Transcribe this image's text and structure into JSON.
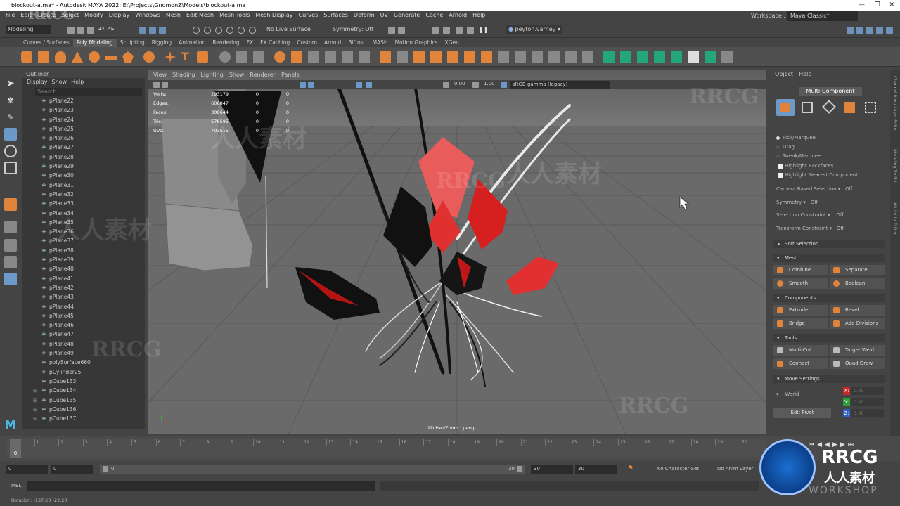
{
  "window": {
    "title": "blockout-a.ma* - Autodesk MAYA 2022: E:\\Projects\\GnomonZ\\Models\\blockout-a.ma"
  },
  "menubar": [
    "File",
    "Edit",
    "Create",
    "Select",
    "Modify",
    "Display",
    "Windows",
    "Mesh",
    "Edit Mesh",
    "Mesh Tools",
    "Mesh Display",
    "Curves",
    "Surfaces",
    "Deform",
    "UV",
    "Generate",
    "Cache",
    "Arnold",
    "Help"
  ],
  "workspace": {
    "label": "Workspace :",
    "value": "Maya Classic*"
  },
  "statusline": {
    "mode": "Modeling",
    "live_surface": "No Live Surface",
    "symmetry": "Symmetry: Off",
    "user": "peyton.varney"
  },
  "shelf_tabs": [
    "Curves / Surfaces",
    "Poly Modeling",
    "Sculpting",
    "Rigging",
    "Animation",
    "Rendering",
    "FX",
    "FX Caching",
    "Custom",
    "Arnold",
    "Bifrost",
    "MASH",
    "Motion Graphics",
    "XGen"
  ],
  "shelf_active": "Poly Modeling",
  "outliner": {
    "title": "Outliner",
    "menus": [
      "Display",
      "Show",
      "Help"
    ],
    "search_placeholder": "Search...",
    "items": [
      "pPlane22",
      "pPlane23",
      "pPlane24",
      "pPlane25",
      "pPlane26",
      "pPlane27",
      "pPlane28",
      "pPlane29",
      "pPlane30",
      "pPlane31",
      "pPlane32",
      "pPlane33",
      "pPlane34",
      "pPlane35",
      "pPlane36",
      "pPlane37",
      "pPlane38",
      "pPlane39",
      "pPlane40",
      "pPlane41",
      "pPlane42",
      "pPlane43",
      "pPlane44",
      "pPlane45",
      "pPlane46",
      "pPlane47",
      "pPlane48",
      "pPlane49",
      "polySurface660",
      "pCylinder25",
      "pCube133",
      "pCube134",
      "pCube135",
      "pCube136",
      "pCube137"
    ]
  },
  "viewport": {
    "menus": [
      "View",
      "Shading",
      "Lighting",
      "Show",
      "Renderer",
      "Panels"
    ],
    "exposure": "0.00",
    "gamma": "1.00",
    "colorspace": "sRGB gamma (legacy)",
    "camera": "2D Pan/Zoom : persp",
    "hud": [
      {
        "label": "Verts:",
        "value": "293179",
        "a": "0",
        "b": "0"
      },
      {
        "label": "Edges:",
        "value": "600847",
        "a": "0",
        "b": "0"
      },
      {
        "label": "Faces:",
        "value": "308644",
        "a": "0",
        "b": "0"
      },
      {
        "label": "Tris:",
        "value": "576585",
        "a": "0",
        "b": "0"
      },
      {
        "label": "UVs:",
        "value": "703515",
        "a": "0",
        "b": "0"
      }
    ]
  },
  "toolkit": {
    "menus": [
      "Object",
      "Help"
    ],
    "mode": "Multi-Component",
    "pick": "Pick/Marquee",
    "drag": "Drag",
    "tweak": "Tweak/Marquee",
    "backfaces": "Highlight Backfaces",
    "nearest": "Highlight Nearest Component",
    "camera_sel": "Camera Based Selection",
    "camera_sel_val": "Off",
    "symmetry": "Symmetry",
    "symmetry_val": "Off",
    "sel_constraint": "Selection Constraint",
    "sel_constraint_val": "Off",
    "transform_constraint": "Transform Constraint",
    "transform_constraint_val": "Off",
    "soft_selection": "Soft Selection",
    "mesh": {
      "title": "Mesh",
      "buttons": [
        "Combine",
        "Separate",
        "Smooth",
        "Boolean"
      ]
    },
    "components": {
      "title": "Components",
      "buttons": [
        "Extrude",
        "Bevel",
        "Bridge",
        "Add Divisions"
      ]
    },
    "tools": {
      "title": "Tools",
      "buttons": [
        "Multi-Cut",
        "Target Weld",
        "Connect",
        "Quad Draw"
      ]
    },
    "move_settings": {
      "title": "Move Settings",
      "space": "World",
      "edit_pivot": "Edit Pivot",
      "x": "X:",
      "y": "Y:",
      "z": "Z:",
      "xv": "0.00",
      "yv": "0.00",
      "zv": "0.00"
    }
  },
  "right_strip": [
    "Channel Box / Layer Editor",
    "Modeling Toolkit",
    "Attribute Editor"
  ],
  "timeline": {
    "current": "0",
    "ticks": [
      "0",
      "1",
      "2",
      "3",
      "4",
      "5",
      "6",
      "7",
      "8",
      "9",
      "10",
      "11",
      "12",
      "13",
      "14",
      "15",
      "16",
      "17",
      "18",
      "19",
      "20",
      "21",
      "22",
      "23",
      "24",
      "25",
      "26",
      "27",
      "28",
      "29",
      "30"
    ],
    "range_start": "0",
    "range_start2": "0",
    "slider_start": "0",
    "slider_end": "30",
    "range_end": "30",
    "range_end2": "30",
    "character_set": "No Character Set",
    "anim_layer": "No Anim Layer"
  },
  "cmdline": {
    "label": "MEL"
  },
  "helpline": {
    "text": "Rotation:   -137.20      -22.20"
  },
  "watermark": {
    "text": "RRCG",
    "cn": "人人素材",
    "sub": "RRCG",
    "sub2": "人人素材",
    "ws": "WORKSHOP"
  }
}
